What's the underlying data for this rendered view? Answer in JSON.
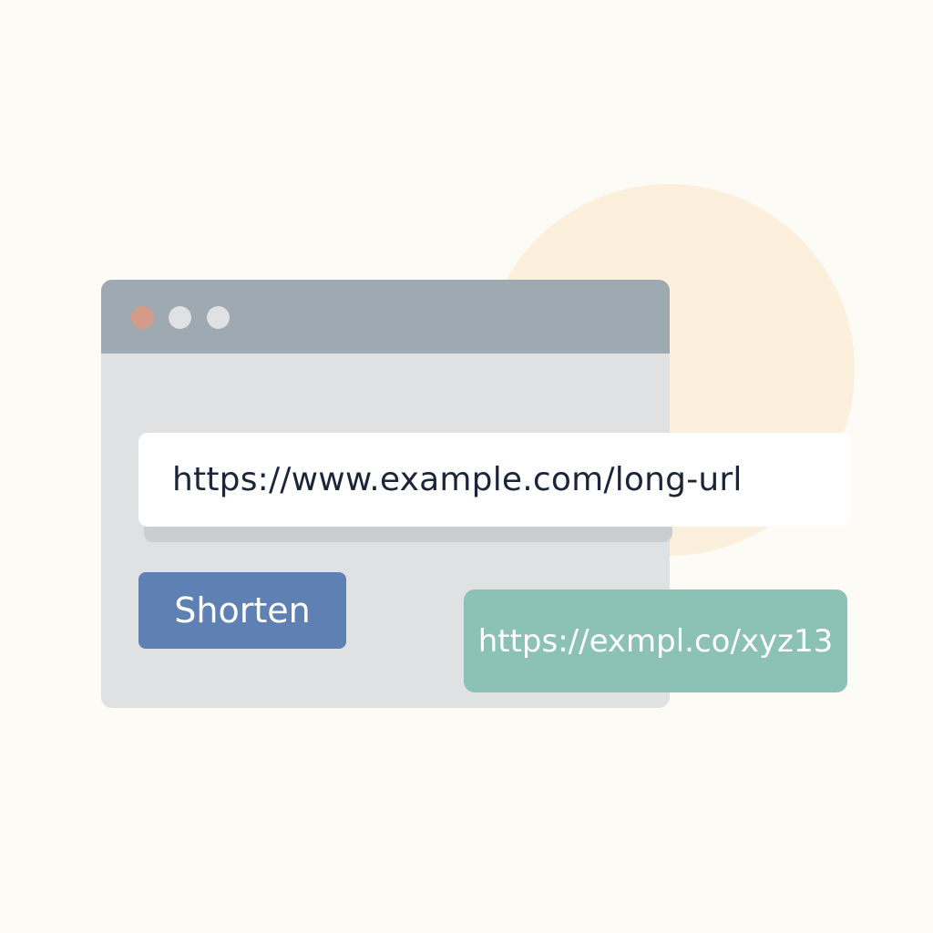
{
  "window": {
    "controls": [
      "close",
      "minimize",
      "maximize"
    ]
  },
  "input": {
    "value": "https://www.example.com/long-url"
  },
  "actions": {
    "shorten_label": "Shorten"
  },
  "result": {
    "short_url": "https://exmpl.co/xyz13"
  },
  "colors": {
    "background": "#fcfbf6",
    "accent_circle": "#fcefdc",
    "titlebar": "#9ea9b2",
    "window_body": "#e0e1e2",
    "close_dot": "#d49b89",
    "button": "#5e80b2",
    "result": "#8cc1b6",
    "text_dark": "#1c2438"
  }
}
